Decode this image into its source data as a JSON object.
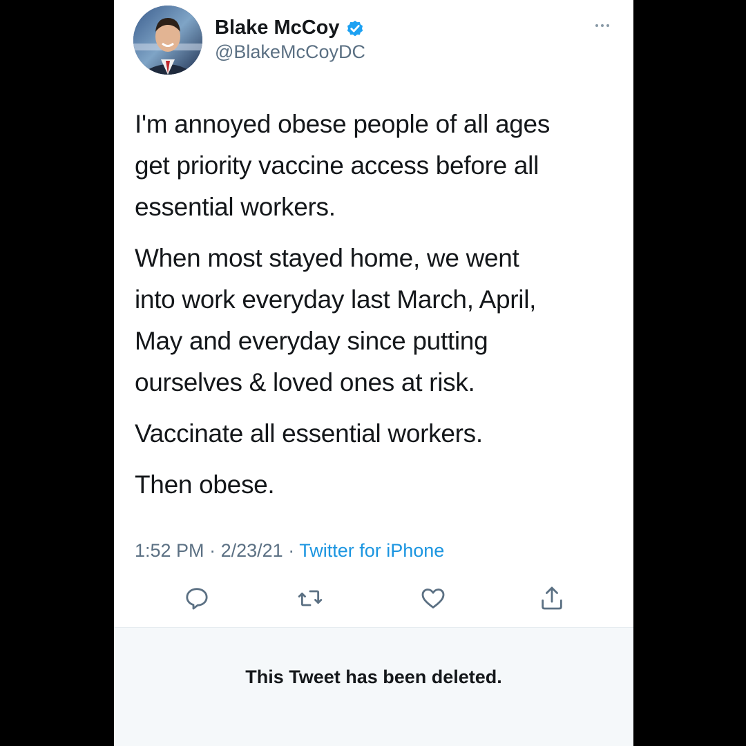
{
  "tweet": {
    "display_name": "Blake McCoy",
    "handle": "@BlakeMcCoyDC",
    "verified": true,
    "paragraphs": [
      "I'm annoyed obese people of all ages\nget priority vaccine access before all\nessential workers.",
      "When most stayed home, we went\ninto work everyday last March, April,\nMay and everyday since putting\nourselves & loved ones at risk.",
      "Vaccinate all essential workers.",
      "Then obese."
    ],
    "time": "1:52 PM",
    "date": "2/23/21",
    "separator": "·",
    "source": "Twitter for iPhone"
  },
  "actions": {
    "reply_icon": "reply-icon",
    "retweet_icon": "retweet-icon",
    "like_icon": "like-icon",
    "share_icon": "share-icon"
  },
  "status": {
    "deleted_message": "This Tweet has been deleted."
  },
  "colors": {
    "background": "#000000",
    "card": "#ffffff",
    "text": "#14171a",
    "secondary": "#5b7083",
    "link": "#1b95e0",
    "verified": "#1da1f2",
    "deleted_panel": "#f5f8fa"
  }
}
